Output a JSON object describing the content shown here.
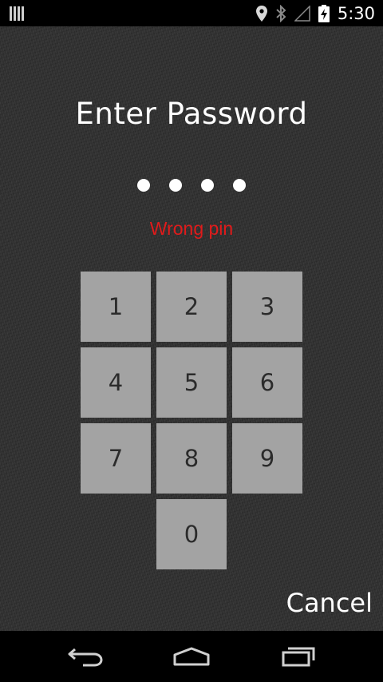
{
  "status_bar": {
    "time": "5:30",
    "icons": [
      "notification-bars-icon",
      "location-icon",
      "bluetooth-icon",
      "signal-icon",
      "battery-charging-icon"
    ]
  },
  "lock_screen": {
    "title": "Enter Password",
    "entered_digits_count": 4,
    "error_message": "Wrong pin",
    "error_color": "#e01b1b",
    "keys": [
      "1",
      "2",
      "3",
      "4",
      "5",
      "6",
      "7",
      "8",
      "9",
      "0"
    ],
    "cancel_label": "Cancel"
  },
  "nav_bar": {
    "buttons": [
      "back-icon",
      "home-icon",
      "recent-apps-icon"
    ]
  }
}
